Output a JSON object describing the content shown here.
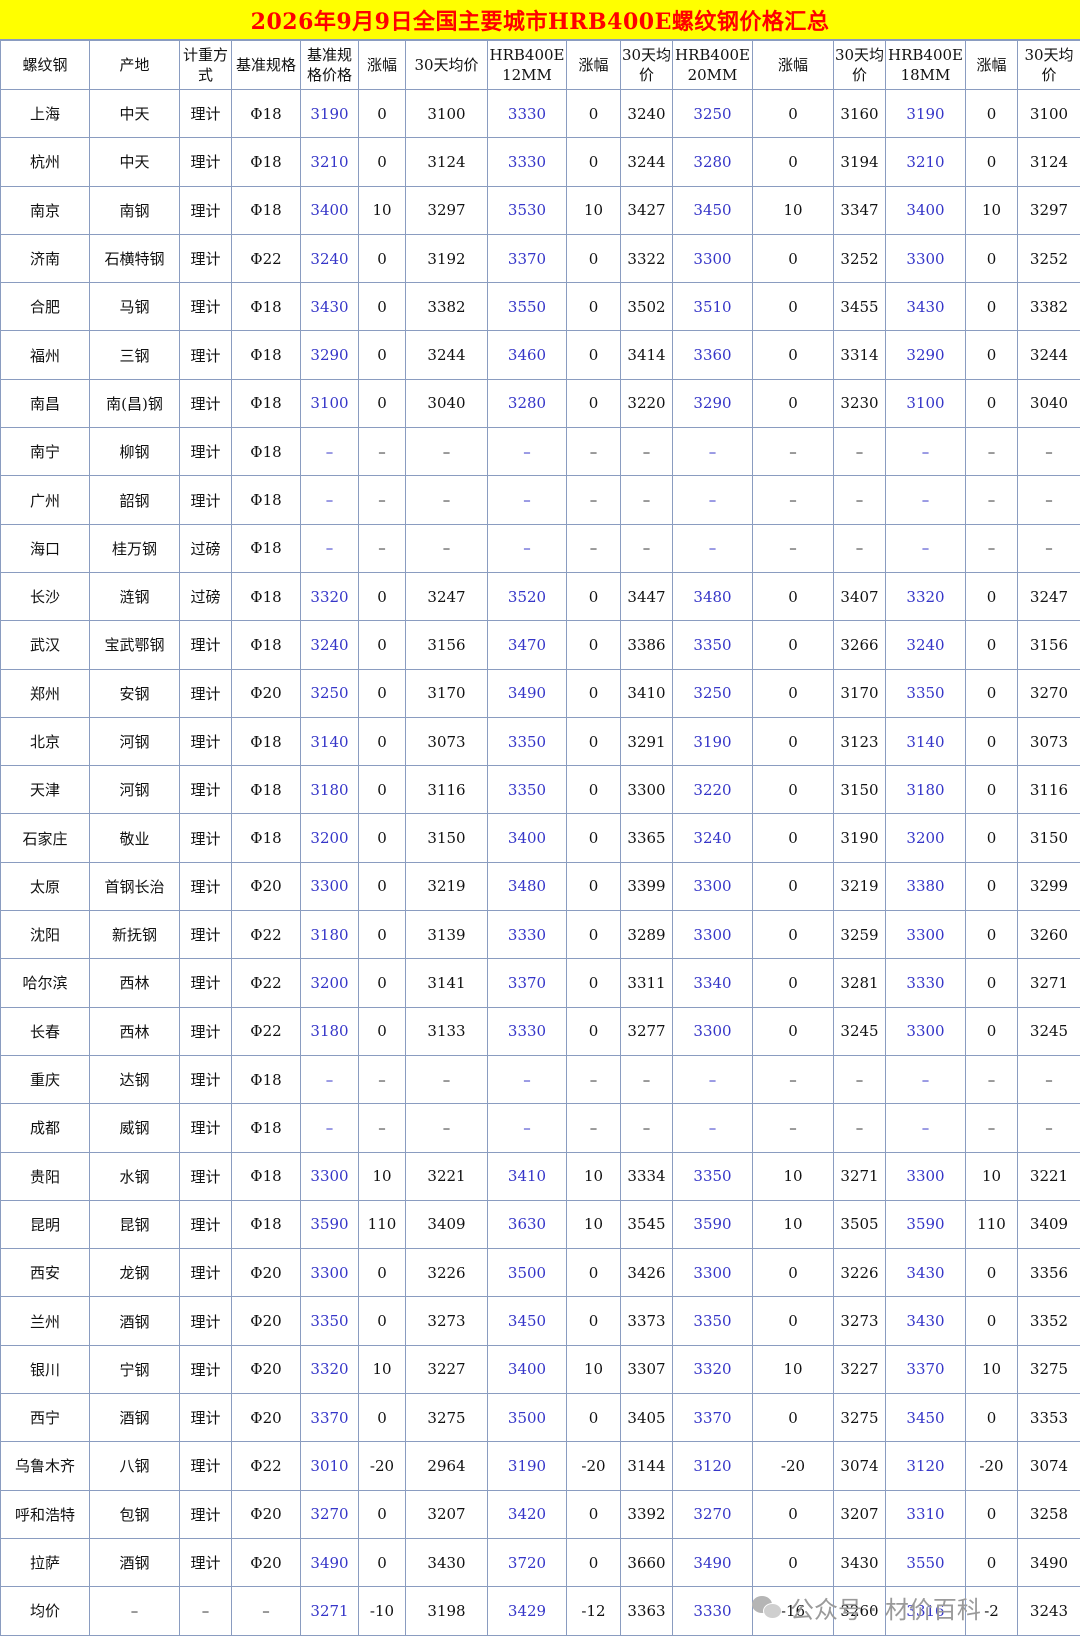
{
  "title": "2026年9月9日全国主要城市HRB400E螺纹钢价格汇总",
  "colors": {
    "title_bg": "#ffff00",
    "title_text": "#ff0000",
    "price_text": "#3535c8",
    "grid": "#8a9cc0"
  },
  "headers": [
    "螺纹钢",
    "产地",
    "计重方式",
    "基准规格",
    "基准规格价格",
    "涨幅",
    "30天均价",
    "HRB400E 12MM",
    "涨幅",
    "30天均价",
    "HRB400E 20MM",
    "涨幅",
    "30天均价",
    "HRB400E 18MM",
    "涨幅",
    "30天均价"
  ],
  "rows": [
    [
      "上海",
      "中天",
      "理计",
      "Φ18",
      "3190",
      "0",
      "3100",
      "3330",
      "0",
      "3240",
      "3250",
      "0",
      "3160",
      "3190",
      "0",
      "3100"
    ],
    [
      "杭州",
      "中天",
      "理计",
      "Φ18",
      "3210",
      "0",
      "3124",
      "3330",
      "0",
      "3244",
      "3280",
      "0",
      "3194",
      "3210",
      "0",
      "3124"
    ],
    [
      "南京",
      "南钢",
      "理计",
      "Φ18",
      "3400",
      "10",
      "3297",
      "3530",
      "10",
      "3427",
      "3450",
      "10",
      "3347",
      "3400",
      "10",
      "3297"
    ],
    [
      "济南",
      "石横特钢",
      "理计",
      "Φ22",
      "3240",
      "0",
      "3192",
      "3370",
      "0",
      "3322",
      "3300",
      "0",
      "3252",
      "3300",
      "0",
      "3252"
    ],
    [
      "合肥",
      "马钢",
      "理计",
      "Φ18",
      "3430",
      "0",
      "3382",
      "3550",
      "0",
      "3502",
      "3510",
      "0",
      "3455",
      "3430",
      "0",
      "3382"
    ],
    [
      "福州",
      "三钢",
      "理计",
      "Φ18",
      "3290",
      "0",
      "3244",
      "3460",
      "0",
      "3414",
      "3360",
      "0",
      "3314",
      "3290",
      "0",
      "3244"
    ],
    [
      "南昌",
      "南(昌)钢",
      "理计",
      "Φ18",
      "3100",
      "0",
      "3040",
      "3280",
      "0",
      "3220",
      "3290",
      "0",
      "3230",
      "3100",
      "0",
      "3040"
    ],
    [
      "南宁",
      "柳钢",
      "理计",
      "Φ18",
      "–",
      "–",
      "–",
      "–",
      "–",
      "–",
      "–",
      "–",
      "–",
      "–",
      "–",
      "–"
    ],
    [
      "广州",
      "韶钢",
      "理计",
      "Φ18",
      "–",
      "–",
      "–",
      "–",
      "–",
      "–",
      "–",
      "–",
      "–",
      "–",
      "–",
      "–"
    ],
    [
      "海口",
      "桂万钢",
      "过磅",
      "Φ18",
      "–",
      "–",
      "–",
      "–",
      "–",
      "–",
      "–",
      "–",
      "–",
      "–",
      "–",
      "–"
    ],
    [
      "长沙",
      "涟钢",
      "过磅",
      "Φ18",
      "3320",
      "0",
      "3247",
      "3520",
      "0",
      "3447",
      "3480",
      "0",
      "3407",
      "3320",
      "0",
      "3247"
    ],
    [
      "武汉",
      "宝武鄂钢",
      "理计",
      "Φ18",
      "3240",
      "0",
      "3156",
      "3470",
      "0",
      "3386",
      "3350",
      "0",
      "3266",
      "3240",
      "0",
      "3156"
    ],
    [
      "郑州",
      "安钢",
      "理计",
      "Φ20",
      "3250",
      "0",
      "3170",
      "3490",
      "0",
      "3410",
      "3250",
      "0",
      "3170",
      "3350",
      "0",
      "3270"
    ],
    [
      "北京",
      "河钢",
      "理计",
      "Φ18",
      "3140",
      "0",
      "3073",
      "3350",
      "0",
      "3291",
      "3190",
      "0",
      "3123",
      "3140",
      "0",
      "3073"
    ],
    [
      "天津",
      "河钢",
      "理计",
      "Φ18",
      "3180",
      "0",
      "3116",
      "3350",
      "0",
      "3300",
      "3220",
      "0",
      "3150",
      "3180",
      "0",
      "3116"
    ],
    [
      "石家庄",
      "敬业",
      "理计",
      "Φ18",
      "3200",
      "0",
      "3150",
      "3400",
      "0",
      "3365",
      "3240",
      "0",
      "3190",
      "3200",
      "0",
      "3150"
    ],
    [
      "太原",
      "首钢长治",
      "理计",
      "Φ20",
      "3300",
      "0",
      "3219",
      "3480",
      "0",
      "3399",
      "3300",
      "0",
      "3219",
      "3380",
      "0",
      "3299"
    ],
    [
      "沈阳",
      "新抚钢",
      "理计",
      "Φ22",
      "3180",
      "0",
      "3139",
      "3330",
      "0",
      "3289",
      "3300",
      "0",
      "3259",
      "3300",
      "0",
      "3260"
    ],
    [
      "哈尔滨",
      "西林",
      "理计",
      "Φ22",
      "3200",
      "0",
      "3141",
      "3370",
      "0",
      "3311",
      "3340",
      "0",
      "3281",
      "3330",
      "0",
      "3271"
    ],
    [
      "长春",
      "西林",
      "理计",
      "Φ22",
      "3180",
      "0",
      "3133",
      "3330",
      "0",
      "3277",
      "3300",
      "0",
      "3245",
      "3300",
      "0",
      "3245"
    ],
    [
      "重庆",
      "达钢",
      "理计",
      "Φ18",
      "–",
      "–",
      "–",
      "–",
      "–",
      "–",
      "–",
      "–",
      "–",
      "–",
      "–",
      "–"
    ],
    [
      "成都",
      "威钢",
      "理计",
      "Φ18",
      "–",
      "–",
      "–",
      "–",
      "–",
      "–",
      "–",
      "–",
      "–",
      "–",
      "–",
      "–"
    ],
    [
      "贵阳",
      "水钢",
      "理计",
      "Φ18",
      "3300",
      "10",
      "3221",
      "3410",
      "10",
      "3334",
      "3350",
      "10",
      "3271",
      "3300",
      "10",
      "3221"
    ],
    [
      "昆明",
      "昆钢",
      "理计",
      "Φ18",
      "3590",
      "110",
      "3409",
      "3630",
      "10",
      "3545",
      "3590",
      "10",
      "3505",
      "3590",
      "110",
      "3409"
    ],
    [
      "西安",
      "龙钢",
      "理计",
      "Φ20",
      "3300",
      "0",
      "3226",
      "3500",
      "0",
      "3426",
      "3300",
      "0",
      "3226",
      "3430",
      "0",
      "3356"
    ],
    [
      "兰州",
      "酒钢",
      "理计",
      "Φ20",
      "3350",
      "0",
      "3273",
      "3450",
      "0",
      "3373",
      "3350",
      "0",
      "3273",
      "3430",
      "0",
      "3352"
    ],
    [
      "银川",
      "宁钢",
      "理计",
      "Φ20",
      "3320",
      "10",
      "3227",
      "3400",
      "10",
      "3307",
      "3320",
      "10",
      "3227",
      "3370",
      "10",
      "3275"
    ],
    [
      "西宁",
      "酒钢",
      "理计",
      "Φ20",
      "3370",
      "0",
      "3275",
      "3500",
      "0",
      "3405",
      "3370",
      "0",
      "3275",
      "3450",
      "0",
      "3353"
    ],
    [
      "乌鲁木齐",
      "八钢",
      "理计",
      "Φ22",
      "3010",
      "-20",
      "2964",
      "3190",
      "-20",
      "3144",
      "3120",
      "-20",
      "3074",
      "3120",
      "-20",
      "3074"
    ],
    [
      "呼和浩特",
      "包钢",
      "理计",
      "Φ20",
      "3270",
      "0",
      "3207",
      "3420",
      "0",
      "3392",
      "3270",
      "0",
      "3207",
      "3310",
      "0",
      "3258"
    ],
    [
      "拉萨",
      "酒钢",
      "理计",
      "Φ20",
      "3490",
      "0",
      "3430",
      "3720",
      "0",
      "3660",
      "3490",
      "0",
      "3430",
      "3550",
      "0",
      "3490"
    ],
    [
      "均价",
      "–",
      "–",
      "–",
      "3271",
      "-10",
      "3198",
      "3429",
      "-12",
      "3363",
      "3330",
      "-16",
      "3260",
      "3316",
      "-2",
      "3243"
    ]
  ],
  "watermark": {
    "icon": "wechat-icon",
    "text": "公众号 · 材价百科"
  }
}
